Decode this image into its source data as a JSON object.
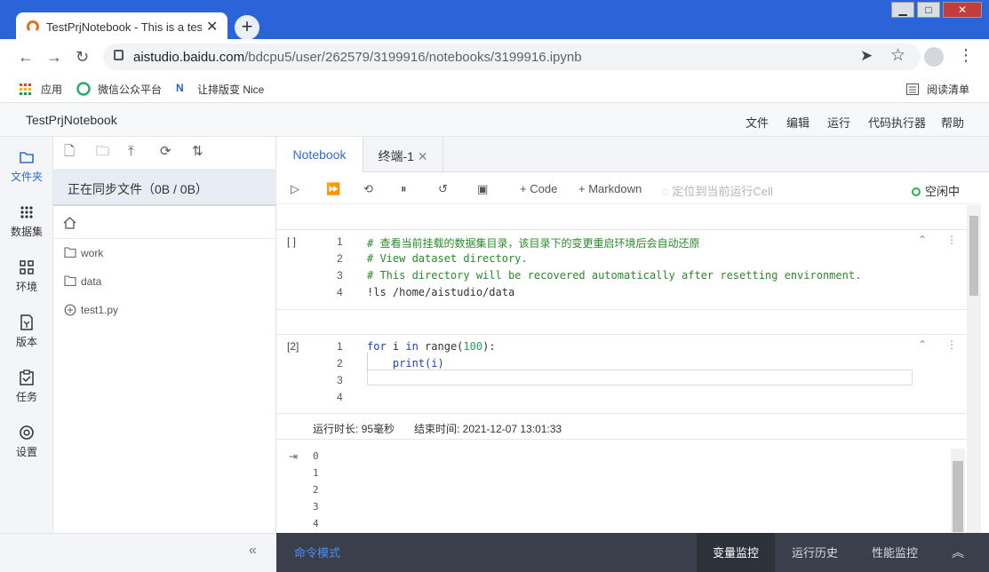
{
  "browser": {
    "tab_title": "TestPrjNotebook - This is a test",
    "new_tab": "+",
    "url_host": "aistudio.baidu.com",
    "url_path": "/bdcpu5/user/262579/3199916/notebooks/3199916.ipynb",
    "bookmarks": [
      "应用",
      "微信公众平台",
      "让排版变 Nice"
    ],
    "reading_list": "阅读清单"
  },
  "app": {
    "name": "TestPrjNotebook",
    "menu": [
      "文件",
      "编辑",
      "运行",
      "代码执行器",
      "帮助"
    ]
  },
  "rail": [
    {
      "label": "文件夹",
      "icon": "folder-icon"
    },
    {
      "label": "数据集",
      "icon": "dataset-icon"
    },
    {
      "label": "环境",
      "icon": "environment-icon"
    },
    {
      "label": "版本",
      "icon": "version-icon"
    },
    {
      "label": "任务",
      "icon": "task-icon"
    },
    {
      "label": "设置",
      "icon": "settings-icon"
    }
  ],
  "files": {
    "sync_status": "正在同步文件（0B / 0B）",
    "items": [
      {
        "name": "work",
        "type": "folder"
      },
      {
        "name": "data",
        "type": "folder"
      },
      {
        "name": "test1.py",
        "type": "python"
      }
    ]
  },
  "notebook": {
    "tabs": [
      "Notebook",
      "终端-1"
    ],
    "toolbar": {
      "add_code": "Code",
      "add_markdown": "Markdown",
      "locate": "定位到当前运行Cell",
      "status": "空闲中"
    },
    "cell1": {
      "prompt": "[ ]",
      "lines": [
        "# 查看当前挂载的数据集目录，该目录下的变更重启环境后会自动还原",
        "# View dataset directory.",
        "# This directory will be recovered automatically after resetting environment.",
        "!ls /home/aistudio/data"
      ]
    },
    "cell2": {
      "prompt": "[2]",
      "line_kw1": "for",
      "line_var": " i ",
      "line_kw2": "in",
      "line_fn": " range(",
      "line_num": "100",
      "line_end": "):",
      "line2": "    print(i)",
      "runtime": "运行时长: 95毫秒",
      "end_time": "结束时间: 2021-12-07 13:01:33",
      "output": [
        "0",
        "1",
        "2",
        "3",
        "4"
      ]
    },
    "line_numbers": [
      "1",
      "2",
      "3",
      "4"
    ]
  },
  "bottombar": {
    "mode": "命令模式",
    "variable_monitor": "变量监控",
    "run_history": "运行历史",
    "perf_monitor": "性能监控"
  }
}
